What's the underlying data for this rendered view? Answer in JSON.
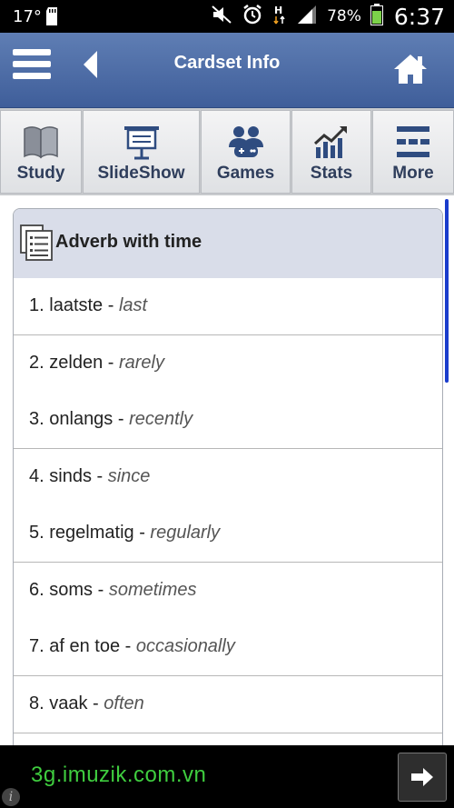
{
  "status_bar": {
    "temperature": "17°",
    "battery": "78%",
    "time": "6:37",
    "icons": [
      "sd-card-icon",
      "mute-icon",
      "alarm-icon",
      "network-h-icon",
      "signal-icon",
      "battery-icon"
    ]
  },
  "app_bar": {
    "title": "Cardset Info",
    "icons": [
      "menu-icon",
      "back-icon",
      "home-icon"
    ]
  },
  "toolbar": {
    "buttons": [
      {
        "label": "Study",
        "icon": "book-icon"
      },
      {
        "label": "SlideShow",
        "icon": "presentation-icon"
      },
      {
        "label": "Games",
        "icon": "games-icon"
      },
      {
        "label": "Stats",
        "icon": "chart-icon"
      },
      {
        "label": "More",
        "icon": "more-icon"
      }
    ]
  },
  "cardset": {
    "title": "Adverb with time",
    "items": [
      {
        "num": "1.",
        "nl": "laatste",
        "sep": " - ",
        "en": "last"
      },
      {
        "num": "2.",
        "nl": "zelden",
        "sep": " - ",
        "en": "rarely"
      },
      {
        "num": "3.",
        "nl": "onlangs",
        "sep": " - ",
        "en": "recently"
      },
      {
        "num": "4.",
        "nl": "sinds",
        "sep": " - ",
        "en": "since"
      },
      {
        "num": "5.",
        "nl": "regelmatig",
        "sep": " - ",
        "en": "regularly"
      },
      {
        "num": "6.",
        "nl": "soms",
        "sep": " - ",
        "en": "sometimes"
      },
      {
        "num": "7.",
        "nl": "af en toe",
        "sep": " - ",
        "en": "occasionally"
      },
      {
        "num": "8.",
        "nl": "vaak",
        "sep": " - ",
        "en": "often"
      }
    ]
  },
  "ad": {
    "text": "3g.imuzik.com.vn",
    "info_glyph": "i"
  },
  "colors": {
    "app_bar": "#4f6ea8",
    "toolbar_label": "#2f3e5c",
    "ad_text": "#3fcd3f",
    "scrollbar": "#1a3ccc"
  }
}
